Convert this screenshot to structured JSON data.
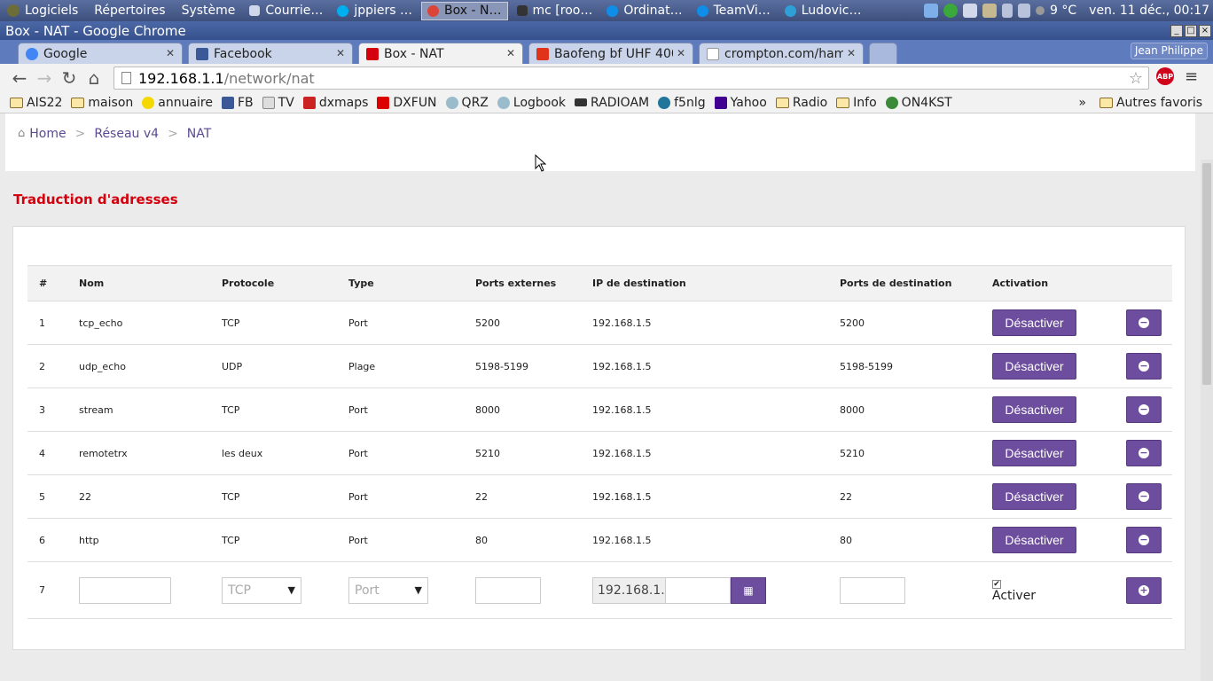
{
  "panel": {
    "menus": [
      "Logiciels",
      "Répertoires",
      "Système"
    ],
    "tasks": [
      "Courrie…",
      "jppiers …",
      "Box - N…",
      "mc [roo…",
      "Ordinat…",
      "TeamVi…",
      "Ludovic…"
    ],
    "weather": "9 °C",
    "clock": "ven. 11 déc., 00:17"
  },
  "window": {
    "title": "Box - NAT - Google Chrome"
  },
  "tabs": [
    {
      "label": "Google",
      "color": "#4285f4"
    },
    {
      "label": "Facebook",
      "color": "#3b5998"
    },
    {
      "label": "Box - NAT",
      "color": "#d4000e"
    },
    {
      "label": "Baofeng bf UHF 400",
      "color": "#e0341a"
    },
    {
      "label": "crompton.com/ham",
      "color": "#999999"
    }
  ],
  "user": "Jean Philippe",
  "omnibox": {
    "host": "192.168.1.1",
    "path": "/network/nat"
  },
  "bookmarks": [
    "AIS22",
    "maison",
    "annuaire",
    "FB",
    "TV",
    "dxmaps",
    "DXFUN",
    "QRZ",
    "Logbook",
    "RADIOAM",
    "f5nlg",
    "Yahoo",
    "Radio",
    "Info",
    "ON4KST"
  ],
  "bookmarks_more": "»",
  "bookmarks_other": "Autres favoris",
  "breadcrumb": {
    "home": "Home",
    "sep": ">",
    "v4": "Réseau v4",
    "current": "NAT"
  },
  "section_title": "Traduction d'adresses",
  "table": {
    "headers": [
      "#",
      "Nom",
      "Protocole",
      "Type",
      "Ports externes",
      "IP de destination",
      "Ports de destination",
      "Activation"
    ],
    "rows": [
      [
        "1",
        "tcp_echo",
        "TCP",
        "Port",
        "5200",
        "192.168.1.5",
        "5200"
      ],
      [
        "2",
        "udp_echo",
        "UDP",
        "Plage",
        "5198-5199",
        "192.168.1.5",
        "5198-5199"
      ],
      [
        "3",
        "stream",
        "TCP",
        "Port",
        "8000",
        "192.168.1.5",
        "8000"
      ],
      [
        "4",
        "remotetrx",
        "les deux",
        "Port",
        "5210",
        "192.168.1.5",
        "5210"
      ],
      [
        "5",
        "22",
        "TCP",
        "Port",
        "22",
        "192.168.1.5",
        "22"
      ],
      [
        "6",
        "http",
        "TCP",
        "Port",
        "80",
        "192.168.1.5",
        "80"
      ]
    ],
    "deactivate_label": "Désactiver",
    "new_row": {
      "index": "7",
      "protocol_selected": "TCP",
      "type_selected": "Port",
      "ip_prefix": "192.168.1.",
      "activate_label": "Activer",
      "activate_checked": true
    }
  }
}
